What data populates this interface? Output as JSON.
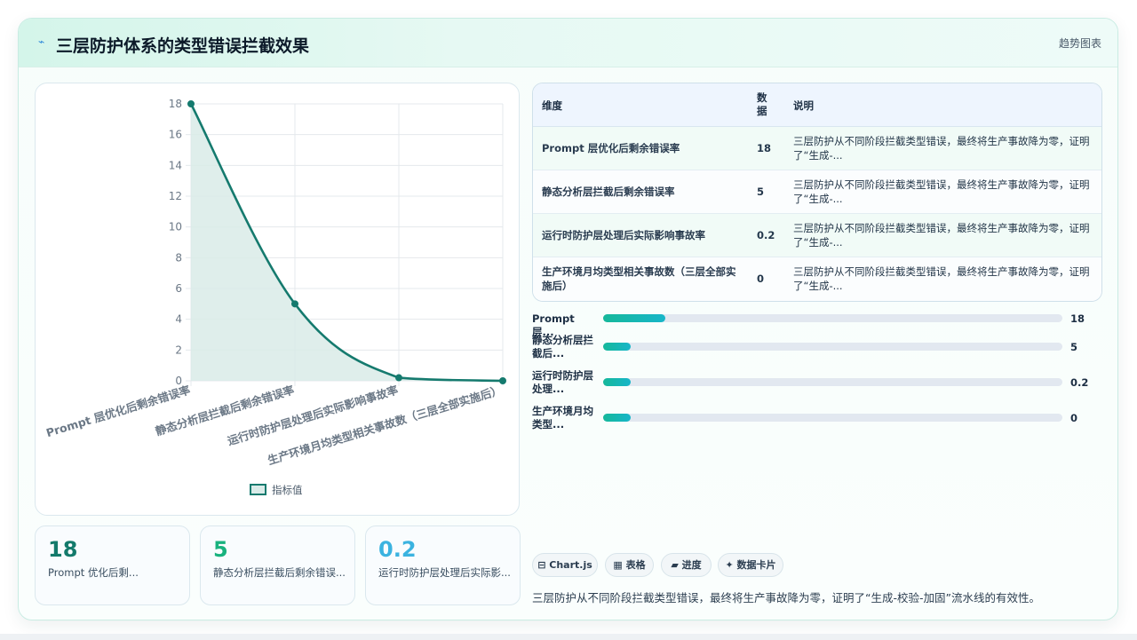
{
  "header": {
    "title": "三层防护体系的类型错误拦截效果",
    "badge": "趋势图表"
  },
  "chart_data": {
    "type": "area",
    "categories": [
      "Prompt 层优化后剩余错误率",
      "静态分析层拦截后剩余错误率",
      "运行时防护层处理后实际影响事故率",
      "生产环境月均类型相关事故数（三层全部实施后）"
    ],
    "series": [
      {
        "name": "指标值",
        "values": [
          18,
          5,
          0.2,
          0
        ]
      }
    ],
    "ylim": [
      0,
      18
    ],
    "yticks": [
      "0",
      "2",
      "4",
      "6",
      "8",
      "10",
      "12",
      "14",
      "16",
      "18"
    ],
    "grid": true,
    "legend": "bottom",
    "colors": {
      "line": "#157a6e",
      "fill": "#d9ebe8"
    }
  },
  "table": {
    "headers": [
      "维度",
      "数\n据",
      "说明"
    ],
    "rows": [
      {
        "name": "Prompt 层优化后剩余错误率",
        "value": "18",
        "desc": "三层防护从不同阶段拦截类型错误，最终将生产事故降为零，证明了“生成-..."
      },
      {
        "name": "静态分析层拦截后剩余错误率",
        "value": "5",
        "desc": "三层防护从不同阶段拦截类型错误，最终将生产事故降为零，证明了“生成-..."
      },
      {
        "name": "运行时防护层处理后实际影响事故率",
        "value": "0.2",
        "desc": "三层防护从不同阶段拦截类型错误，最终将生产事故降为零，证明了“生成-..."
      },
      {
        "name": "生产环境月均类型相关事故数（三层全部实施后）",
        "value": "0",
        "desc": "三层防护从不同阶段拦截类型错误，最终将生产事故降为零，证明了“生成-..."
      }
    ]
  },
  "bars": [
    {
      "label": "Prompt 层...",
      "value": "18",
      "fraction": 0.135
    },
    {
      "label": "静态分析层拦截后...",
      "value": "5",
      "fraction": 0.06
    },
    {
      "label": "运行时防护层处理...",
      "value": "0.2",
      "fraction": 0.06
    },
    {
      "label": "生产环境月均类型...",
      "value": "0",
      "fraction": 0.06
    }
  ],
  "kpis": [
    {
      "value": "18",
      "label": "Prompt 优化后剩...",
      "color": "#137a6b"
    },
    {
      "value": "5",
      "label": "静态分析层拦截后剩余错误...",
      "color": "#19b27e"
    },
    {
      "value": "0.2",
      "label": "运行时防护层处理后实际影...",
      "color": "#3bb3e0"
    }
  ],
  "chips": [
    "⊟ Chart.js",
    "▦ 表格",
    "▰ 进度",
    "✦ 数据卡片"
  ],
  "summary": "三层防护从不同阶段拦截类型错误，最终将生产事故降为零，证明了“生成-校验-加固”流水线的有效性。"
}
